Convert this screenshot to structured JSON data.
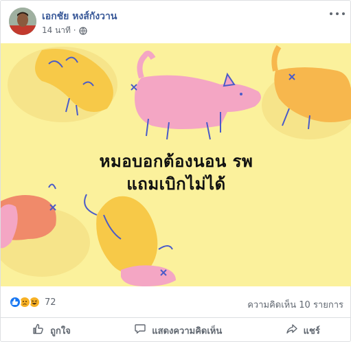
{
  "post": {
    "author": "เอกชัย หงส์กังวาน",
    "timestamp": "14 นาที ·",
    "privacy_icon": "globe-icon",
    "more_icon": "more-options-icon"
  },
  "image": {
    "caption_line1": "หมอบอกต้องนอน รพ",
    "caption_line2": "แถมเบิกไม่ได้",
    "background_color": "#fbf19c"
  },
  "stats": {
    "reaction_icons": [
      "like-icon",
      "sad-icon",
      "haha-icon"
    ],
    "reaction_count": "72",
    "comments_text": "ความคิดเห็น 10 รายการ"
  },
  "actions": {
    "like_label": "ถูกใจ",
    "comment_label": "แสดงความคิดเห็น",
    "share_label": "แชร์"
  },
  "colors": {
    "author_link": "#385898",
    "secondary_text": "#606770",
    "like_blue": "#1877f2"
  }
}
